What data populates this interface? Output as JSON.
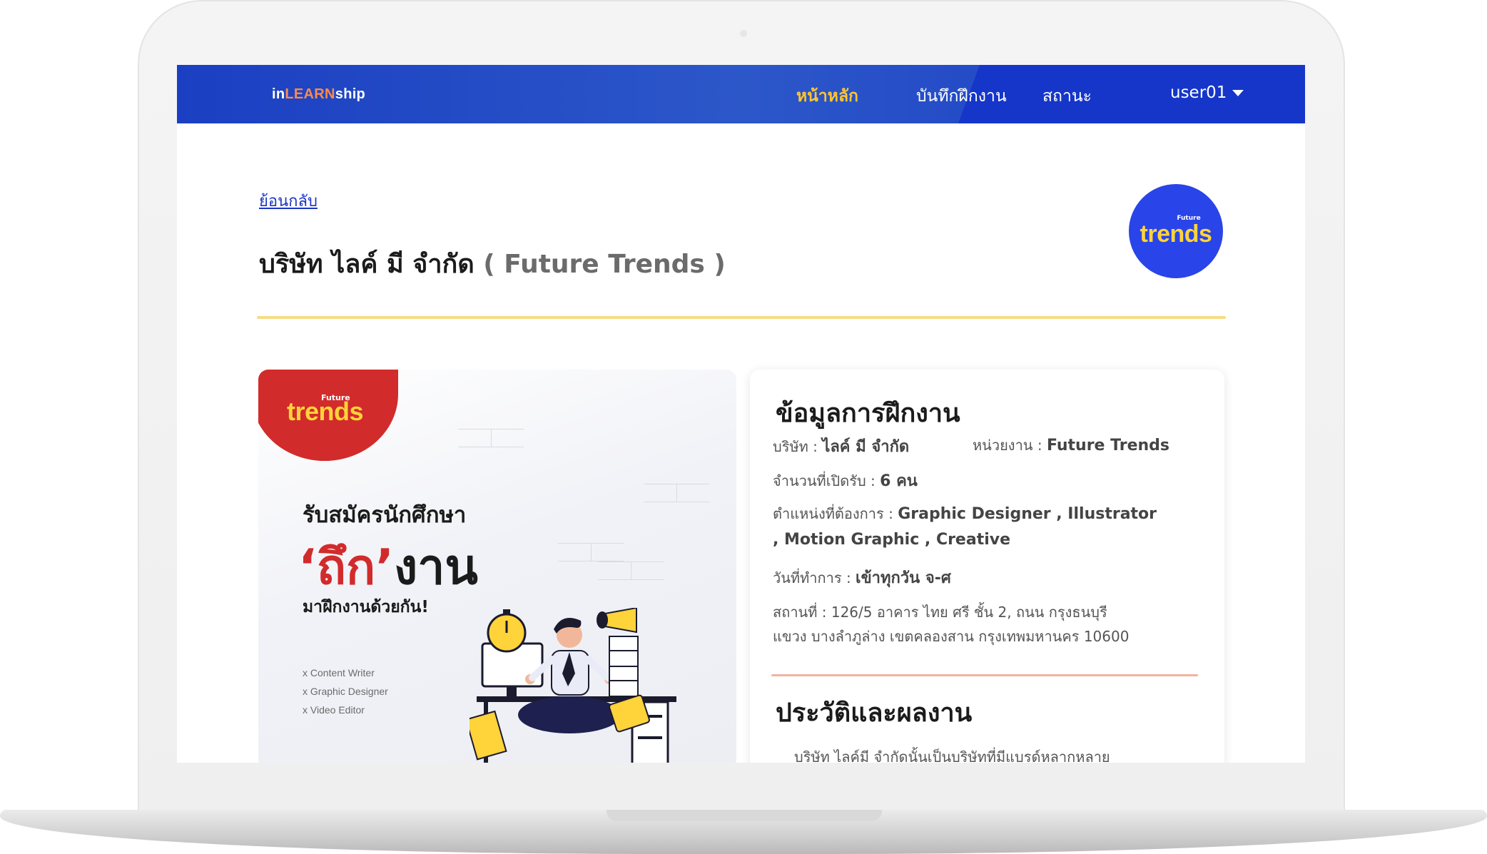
{
  "navbar": {
    "logo_prefix": "in",
    "logo_mid": "LEARN",
    "logo_suffix": "ship",
    "items": [
      "หน้าหลัก",
      "บันทึกฝึกงาน",
      "สถานะ"
    ],
    "user": "user01",
    "active_color": "#ffc52e"
  },
  "page": {
    "back_label": "ย้อนกลับ",
    "company_th": "บริษัท ไลค์ มี จำกัด",
    "company_en_open": "( ",
    "company_en": "Future Trends",
    "company_en_close": " )",
    "logo_small": "Future",
    "logo_word": "trends"
  },
  "poster": {
    "badge_small": "Future",
    "badge_word": "trends",
    "line1": "รับสมัครนักศึกษา",
    "big_quote_open": "‘",
    "big_red": "ถึก",
    "big_quote_close": "’",
    "big_black": "งาน",
    "line3": "มาฝึกงานด้วยกัน!",
    "positions": [
      "x  Content Writer",
      "x  Graphic Designer",
      "x  Video Editor"
    ],
    "brand_red": "#d22b2b"
  },
  "info": {
    "heading": "ข้อมูลการฝึกงาน",
    "company_label": "บริษัท : ",
    "company_value": "ไลค์ มี จำกัด",
    "unit_label": "หน่วยงาน : ",
    "unit_value": "Future Trends",
    "openings_label": "จำนวนที่เปิดรับ : ",
    "openings_value": "6 คน",
    "positions_label": "ตำแหน่งที่ต้องการ : ",
    "positions_value_1": "Graphic Designer , Illustrator",
    "positions_value_2": ", Motion Graphic , Creative",
    "workdays_label": "วันที่ทำการ : ",
    "workdays_value": "เข้าทุกวัน จ-ศ",
    "address_1": "สถานที่ : 126/5 อาคาร ไทย ศรี ชั้น 2, ถนน กรุงธนบุรี",
    "address_2": "แขวง บางลำภูล่าง เขตคลองสาน กรุงเทพมหานคร 10600",
    "history_heading": "ประวัติและผลงาน",
    "history_text": "บริษัท ไลค์มี จำกัดนั้นเป็นบริษัทที่มีแบรด์หลากหลาย"
  }
}
